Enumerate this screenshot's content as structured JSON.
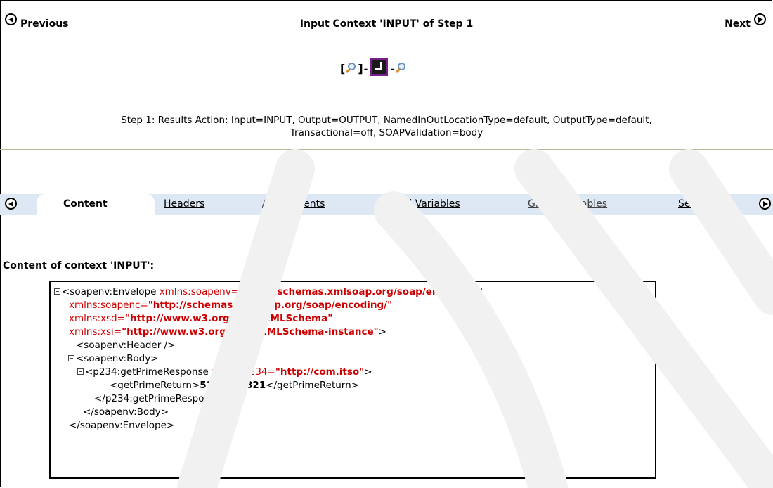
{
  "nav": {
    "previous_label": "Previous",
    "next_label": "Next",
    "title": "Input Context 'INPUT' of Step 1"
  },
  "step_icons": {
    "bracket_open": "[",
    "bracket_close": "]",
    "dash1": "-",
    "dash2": "-"
  },
  "description": {
    "line1": "Step 1: Results Action: Input=INPUT, Output=OUTPUT, NamedInOutLocationType=default, OutputType=default,",
    "line2": "Transactional=off, SOAPValidation=body"
  },
  "tabs": [
    {
      "label": "Content"
    },
    {
      "label": "Headers"
    },
    {
      "label": "Attachments"
    },
    {
      "label": "Local Variables"
    },
    {
      "label": "Global Variables"
    },
    {
      "label": "Service Var"
    }
  ],
  "content_label": "Content of context 'INPUT':",
  "xml": {
    "l1_tag": "<soapenv:Envelope ",
    "l1_attr": "xmlns:soapenv=",
    "l1_val": "\"http://schemas.xmlsoap.org/soap/envelope/\"",
    "l2_attr": "xmlns:soapenc=",
    "l2_val": "\"http://schemas.xmlsoap.org/soap/encoding/\"",
    "l3_attr": "xmlns:xsd=",
    "l3_val": "\"http://www.w3.org/2001/XMLSchema\"",
    "l4_attr": "xmlns:xsi=",
    "l4_val": "\"http://www.w3.org/2001/XMLSchema-instance\"",
    "l4_end": ">",
    "l5": "<soapenv:Header />",
    "l6": "<soapenv:Body>",
    "l7_tag": "<p234:getPrimeResponse ",
    "l7_attr": "xmlns:p234=",
    "l7_val": "\"http://com.itso\"",
    "l7_end": ">",
    "l8_open": "<getPrimeReturn>",
    "l8_value": "5100189821",
    "l8_close": "</getPrimeReturn>",
    "l9": "</p234:getPrimeResponse>",
    "l10": "</soapenv:Body>",
    "l11": "</soapenv:Envelope>"
  },
  "colors": {
    "attr": "#cc0000",
    "separator": "#b9b79a",
    "step_box_border": "#7a1f8a",
    "tab_strip": "#dde8f4"
  }
}
